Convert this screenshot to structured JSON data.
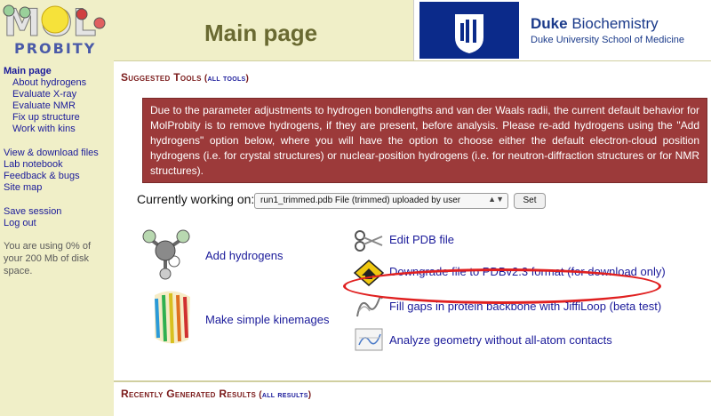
{
  "logo": {
    "top": "MOL",
    "bottom": "PROBITY"
  },
  "header": {
    "title": "Main page",
    "duke_brand": "Duke",
    "duke_dept": "Biochemistry",
    "duke_sub": "Duke University School of Medicine"
  },
  "sidebar": {
    "main_page": "Main page",
    "about_hydrogens": "About hydrogens",
    "evaluate_xray": "Evaluate X-ray",
    "evaluate_nmr": "Evaluate NMR",
    "fix_up_structure": "Fix up structure",
    "work_with_kins": "Work with kins",
    "view_download": "View & download files",
    "lab_notebook": "Lab notebook",
    "feedback_bugs": "Feedback & bugs",
    "site_map": "Site map",
    "save_session": "Save session",
    "log_out": "Log out",
    "disk_usage": "You are using 0% of your 200 Mb of disk space."
  },
  "suggested": {
    "title": "Suggested Tools",
    "paren_open": " (",
    "link": "all tools",
    "paren_close": ")"
  },
  "warning_text": "Due to the parameter adjustments to hydrogen bondlengths and van der Waals radii, the current default behavior for MolProbity is to remove hydrogens, if they are present, before analysis. Please re-add hydrogens using the \"Add hydrogens\" option below, where you will have the option to choose either the default electron-cloud position hydrogens (i.e. for crystal structures) or nuclear-position hydrogens (i.e. for neutron-diffraction structures or for NMR structures).",
  "working": {
    "label": "Currently working on:",
    "selected_file": "run1_trimmed.pdb        File (trimmed) uploaded by user",
    "set_button": "Set"
  },
  "tools": {
    "add_hydrogens": "Add hydrogens",
    "make_kinemages": "Make simple kinemages",
    "edit_pdb": "Edit PDB file",
    "downgrade": "Downgrade file to PDBv2.3 format (for download only)",
    "fill_gaps": "Fill gaps in protein backbone with JiffiLoop (beta test)",
    "analyze_geometry": "Analyze geometry without all-atom contacts"
  },
  "recent": {
    "title": "Recently Generated Results",
    "paren_open": " (",
    "link": "all results",
    "paren_close": ")"
  },
  "colors": {
    "header_bg": "#f0efc8",
    "link": "#1a1a9a",
    "warning_bg": "#9c3a3a",
    "title": "#6a6a32",
    "highlight": "#e02020"
  }
}
